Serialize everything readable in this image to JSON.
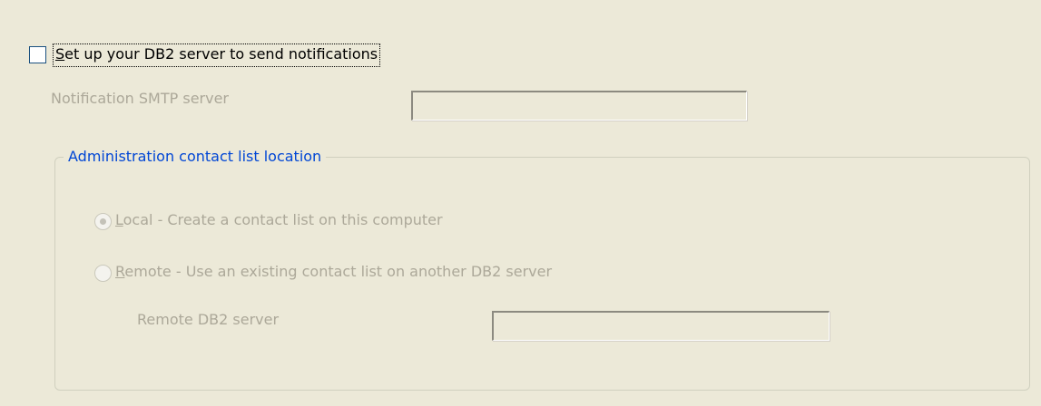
{
  "notifications": {
    "checkbox_label_mnemonic": "S",
    "checkbox_label_rest": "et up your DB2 server to send notifications",
    "checked": false
  },
  "smtp": {
    "label": "Notification SMTP server",
    "value": ""
  },
  "contact_list_group": {
    "title": "Administration contact list location",
    "local": {
      "mnemonic": "L",
      "label_rest": "ocal - Create a contact list on this computer",
      "selected": true
    },
    "remote": {
      "mnemonic": "R",
      "label_rest": "emote - Use an existing contact list on another DB2 server",
      "selected": false
    },
    "remote_server": {
      "label": "Remote DB2 server",
      "value": ""
    }
  },
  "colors": {
    "background": "#ECE9D8",
    "disabled_text": "#ACA899",
    "group_title": "#0046D5",
    "checkbox_border": "#1C5180"
  }
}
